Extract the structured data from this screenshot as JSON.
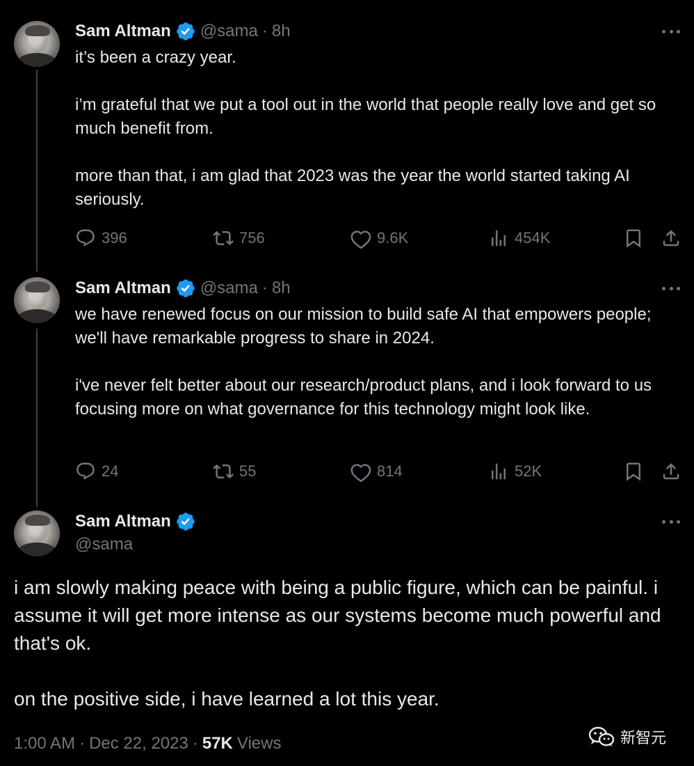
{
  "tweets": [
    {
      "author_name": "Sam Altman",
      "handle": "@sama",
      "separator": "·",
      "time": "8h",
      "paragraphs": [
        "it’s been a crazy year.",
        "i’m grateful that we put a tool out in the world that people really love and get so much benefit from.",
        "more than that, i am glad that 2023 was the year the world started taking AI seriously."
      ],
      "replies": "396",
      "reposts": "756",
      "likes": "9.6K",
      "views": "454K"
    },
    {
      "author_name": "Sam Altman",
      "handle": "@sama",
      "separator": "·",
      "time": "8h",
      "paragraphs": [
        "we have renewed focus on our mission to build safe AI that empowers people; we'll have remarkable progress to share in 2024.",
        "i've never felt better about our research/product plans, and i look forward to us focusing more on what governance for this technology might look like."
      ],
      "replies": "24",
      "reposts": "55",
      "likes": "814",
      "views": "52K"
    }
  ],
  "main_tweet": {
    "author_name": "Sam Altman",
    "handle": "@sama",
    "paragraphs": [
      "i am slowly making peace with being a public figure, which can be painful. i assume it will get more intense as our systems become much powerful and that's ok.",
      "on the positive side, i have learned a lot this year."
    ],
    "time": "1:00 AM",
    "date": "Dec 22, 2023",
    "separator": "·",
    "views_count": "57K",
    "views_label": "Views"
  },
  "watermark": {
    "text": "新智元",
    "icon": "wechat-icon"
  },
  "colors": {
    "background": "#000000",
    "text_primary": "#e7e9ea",
    "text_secondary": "#71767b",
    "verified_blue": "#1d9bf0",
    "thread_line": "#3e4144"
  }
}
